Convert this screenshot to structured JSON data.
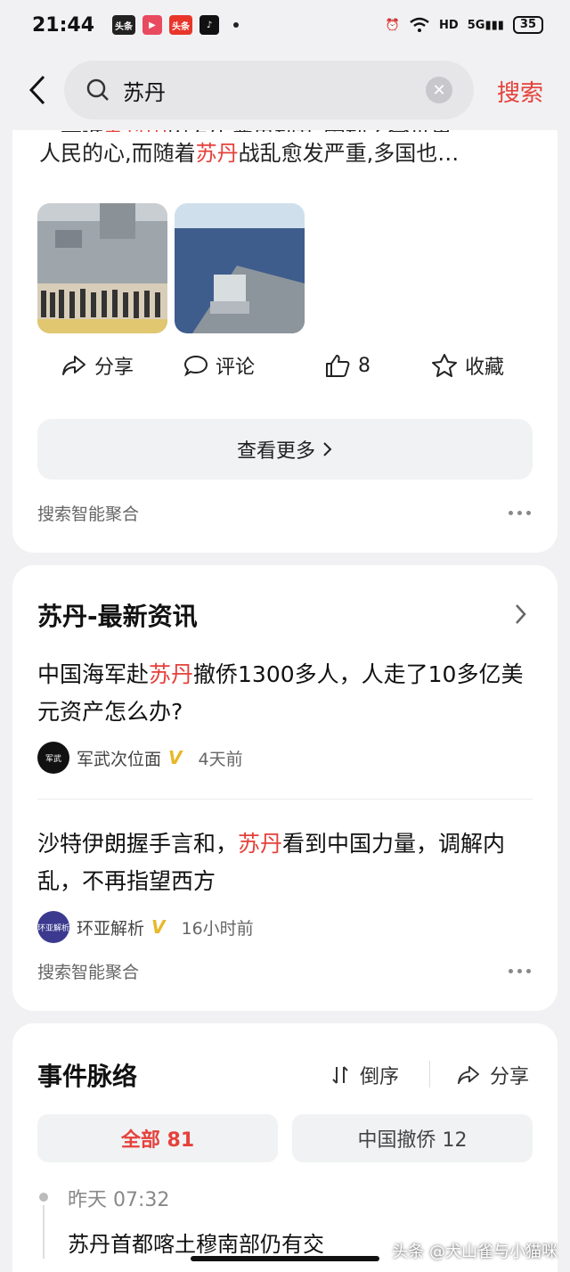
{
  "status": {
    "time": "21:44",
    "apps": [
      "头条",
      "",
      "头条",
      ""
    ],
    "network": "5G",
    "hd": "HD",
    "battery": "35"
  },
  "search": {
    "query": "苏丹",
    "submit_label": "搜索"
  },
  "card1": {
    "snippet_line1_parts": [
      "…最近",
      "苏丹国",
      "内发生严重动乱,牵动了全世界"
    ],
    "snippet_line2_parts": [
      "人民的心,而随着",
      "苏丹",
      "战乱愈发严重,多国也…"
    ],
    "actions": {
      "share": "分享",
      "comment": "评论",
      "like_count": "8",
      "collect": "收藏"
    },
    "more_label": "查看更多",
    "footer": "搜索智能聚合"
  },
  "card2": {
    "title": "苏丹-最新资讯",
    "items": [
      {
        "title_parts": [
          "中国海军赴",
          "苏丹",
          "撤侨1300多人，人走了10多亿美元资产怎么办?"
        ],
        "source": "军武次位面",
        "avatar_text": "军武",
        "time": "4天前"
      },
      {
        "title_parts": [
          "沙特伊朗握手言和，",
          "苏丹",
          "看到中国力量，调解内乱，不再指望西方"
        ],
        "source": "环亚解析",
        "avatar_text": "环亚解析",
        "time": "16小时前"
      }
    ],
    "footer": "搜索智能聚合"
  },
  "card3": {
    "title": "事件脉络",
    "sort_label": "倒序",
    "share_label": "分享",
    "tabs": [
      {
        "label": "全部 81"
      },
      {
        "label": "中国撤侨 12"
      }
    ],
    "timeline": [
      {
        "time": "昨天 07:32",
        "text": "苏丹首都喀土穆南部仍有交"
      }
    ]
  },
  "watermark": "头条 @犬山雀与小猫咪"
}
